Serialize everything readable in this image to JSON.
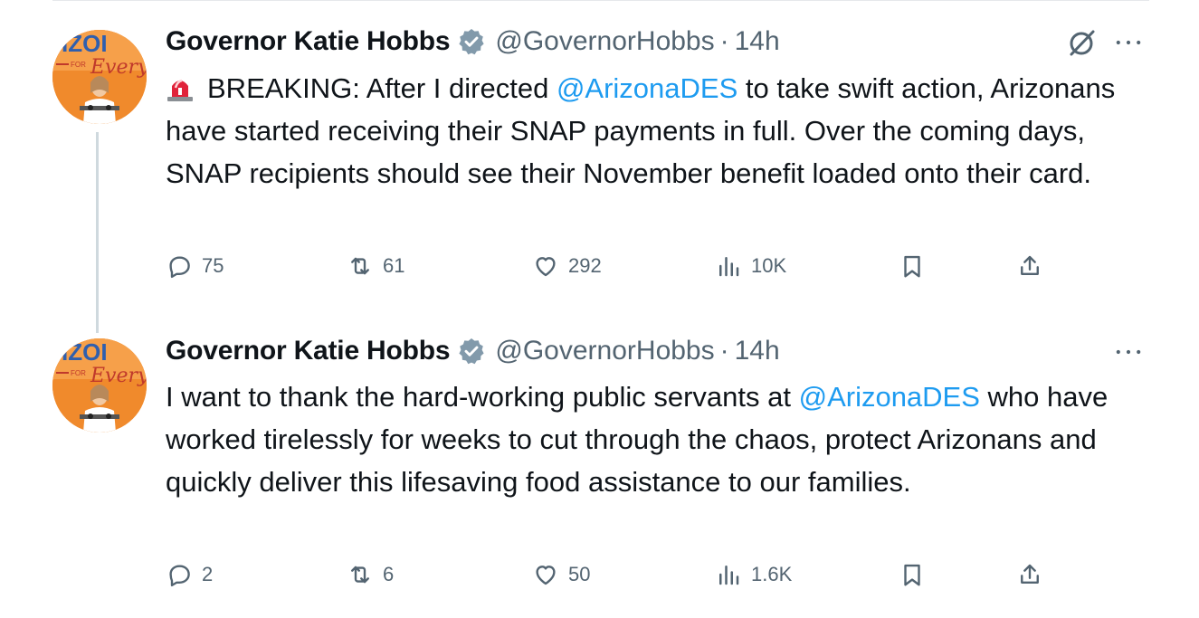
{
  "tweets": [
    {
      "author": {
        "name": "Governor Katie Hobbs",
        "handle": "@GovernorHobbs",
        "time": "14h",
        "verified": true
      },
      "avatar_text": {
        "top": "IZOI",
        "for": "FOR",
        "every": "Every"
      },
      "text_parts": {
        "prefix": "BREAKING: After I directed ",
        "mention": "@ArizonaDES",
        "suffix": " to take swift action, Arizonans have started receiving their SNAP payments in full. Over the coming days, SNAP recipients should see their November benefit loaded onto their card."
      },
      "leading_emoji": "siren-icon",
      "stats": {
        "replies": "75",
        "reposts": "61",
        "likes": "292",
        "views": "10K"
      }
    },
    {
      "author": {
        "name": "Governor Katie Hobbs",
        "handle": "@GovernorHobbs",
        "time": "14h",
        "verified": true
      },
      "avatar_text": {
        "top": "IZOI",
        "for": "FOR",
        "every": "Every"
      },
      "text_parts": {
        "prefix": "I want to thank the hard-working public servants at ",
        "mention": "@ArizonaDES",
        "suffix": " who have worked tirelessly for weeks to cut through the chaos, protect Arizonans and quickly deliver this lifesaving food assistance to our families."
      },
      "stats": {
        "replies": "2",
        "reposts": "6",
        "likes": "50",
        "views": "1.6K"
      }
    }
  ],
  "colors": {
    "accent": "#1d9bf0",
    "muted": "#536471",
    "text": "#0f1419",
    "avatar_bg": "#f08a2c"
  }
}
